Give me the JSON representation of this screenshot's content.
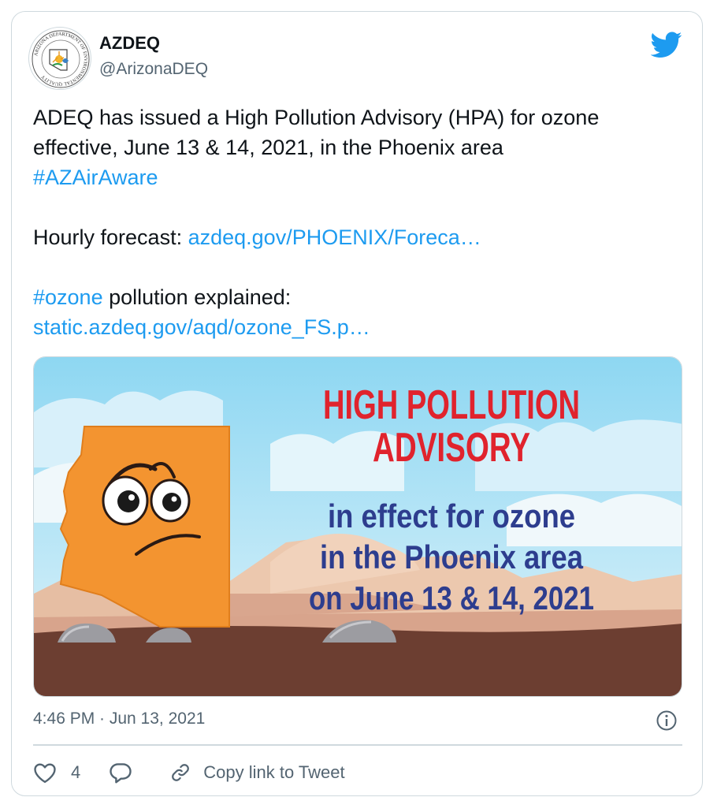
{
  "author": {
    "name": "AZDEQ",
    "handle": "@ArizonaDEQ",
    "avatar_icon": "azdeq-seal-logo",
    "avatar_text": "ARIZONA DEPARTMENT OF ENVIRONMENTAL QUALITY"
  },
  "platform_icon": "twitter-bird-icon",
  "tweet": {
    "line1": "ADEQ has issued a High Pollution Advisory (HPA) for ozone effective, June 13 & 14, 2021, in the Phoenix area",
    "hashtag1": "#AZAirAware",
    "forecast_label": "Hourly forecast:",
    "forecast_link": "azdeq.gov/PHOENIX/Foreca…",
    "hashtag2": "#ozone",
    "ozone_text": "pollution explained:",
    "ozone_link": "static.azdeq.gov/aqd/ozone_FS.p…"
  },
  "media": {
    "headline1": "HIGH POLLUTION",
    "headline2": "ADVISORY",
    "line1": "in effect for ozone",
    "line2": "in the Phoenix area",
    "line3": "on June 13 & 14, 2021"
  },
  "timestamp": "4:46 PM · Jun 13, 2021",
  "actions": {
    "like_count": "4",
    "copy_link_label": "Copy link to Tweet"
  },
  "colors": {
    "link": "#1d9bf0",
    "brand": "#1d9bf0",
    "headline_red": "#e0232d",
    "text_navy": "#2d3d8e",
    "arizona_orange": "#f39430"
  }
}
